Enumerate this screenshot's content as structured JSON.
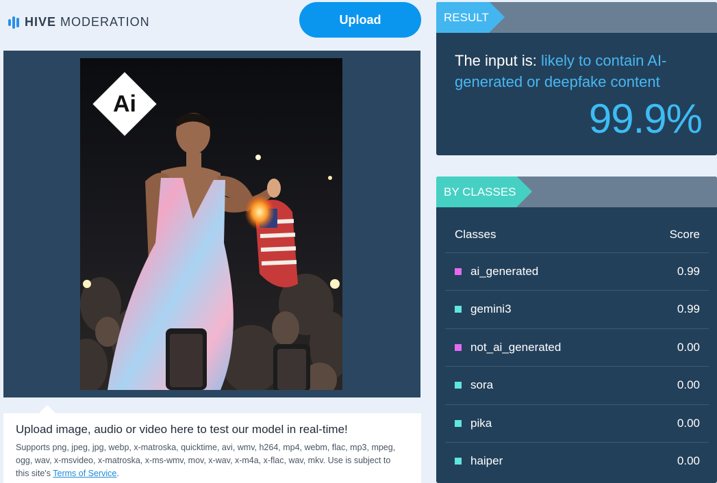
{
  "header": {
    "brand_bold": "HIVE",
    "brand_light": "MODERATION",
    "upload_label": "Upload"
  },
  "preview": {
    "badge_text": "Ai"
  },
  "info": {
    "title": "Upload image, audio or video here to test our model in real-time!",
    "supports_text": "Supports png, jpeg, jpg, webp, x-matroska, quicktime, avi, wmv, h264, mp4, webm, flac, mp3, mpeg, ogg, wav, x-msvideo, x-matroska, x-ms-wmv, mov, x-wav, x-m4a, x-flac, wav, mkv. Use is subject to this site's ",
    "terms_link": "Terms of Service",
    "period": "."
  },
  "result": {
    "tab_label": "RESULT",
    "prefix": "The input is: ",
    "verdict": "likely to contain AI-generated or deepfake content",
    "score": "99.9%"
  },
  "by_classes": {
    "tab_label": "BY CLASSES",
    "col_class": "Classes",
    "col_score": "Score",
    "rows": [
      {
        "name": "ai_generated",
        "score": "0.99",
        "color": "#e36bf0"
      },
      {
        "name": "gemini3",
        "score": "0.99",
        "color": "#5fe6e0"
      },
      {
        "name": "not_ai_generated",
        "score": "0.00",
        "color": "#e36bf0"
      },
      {
        "name": "sora",
        "score": "0.00",
        "color": "#5fe6e0"
      },
      {
        "name": "pika",
        "score": "0.00",
        "color": "#5fe6e0"
      },
      {
        "name": "haiper",
        "score": "0.00",
        "color": "#5fe6e0"
      }
    ]
  },
  "colors": {
    "accent_blue": "#0a96ef",
    "result_tab": "#43b6f0",
    "classes_tab": "#45d0c3",
    "panel_bg": "#23405a"
  },
  "icons": {
    "logo": "hive-logo-icon",
    "ai_badge": "ai-generated-badge-icon"
  }
}
